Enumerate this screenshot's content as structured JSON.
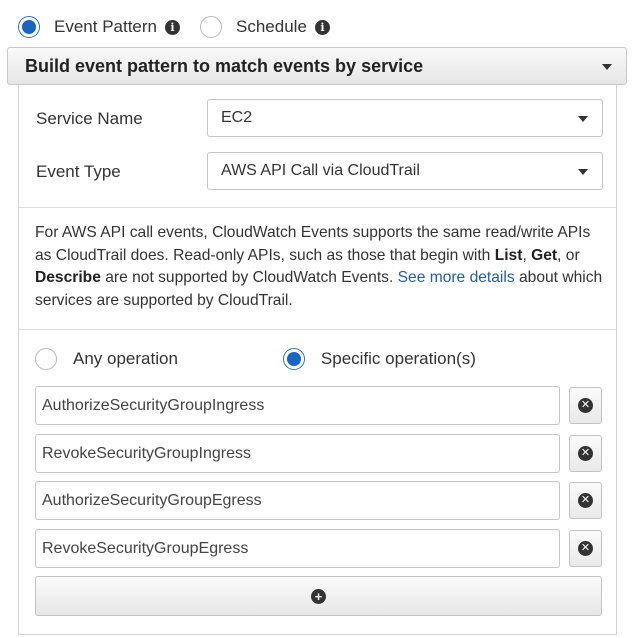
{
  "source_mode": {
    "options": [
      {
        "label": "Event Pattern",
        "selected": true
      },
      {
        "label": "Schedule",
        "selected": false
      }
    ],
    "info_icon": "info-icon"
  },
  "builder": {
    "header_title": "Build event pattern to match events by service",
    "service_name": {
      "label": "Service Name",
      "value": "EC2"
    },
    "event_type": {
      "label": "Event Type",
      "value": "AWS API Call via CloudTrail"
    },
    "help": {
      "part1": "For AWS API call events, CloudWatch Events supports the same read/write APIs as CloudTrail does. Read-only APIs, such as those that begin with ",
      "bold1": "List",
      "part2": ", ",
      "bold2": "Get",
      "part3": ", or ",
      "bold3": "Describe",
      "part4": " are not supported by CloudWatch Events. ",
      "link": "See more details",
      "part5": " about which services are supported by CloudTrail."
    },
    "operation_scope": {
      "any_label": "Any operation",
      "specific_label": "Specific operation(s)",
      "selected": "specific"
    },
    "operations": [
      "AuthorizeSecurityGroupIngress",
      "RevokeSecurityGroupIngress",
      "AuthorizeSecurityGroupEgress",
      "RevokeSecurityGroupEgress"
    ],
    "remove_icon": "close-circle-icon",
    "add_icon": "plus-circle-icon"
  },
  "colors": {
    "accent": "#1a65c0",
    "link": "#1f5fa6",
    "icon_dark": "#333333"
  }
}
